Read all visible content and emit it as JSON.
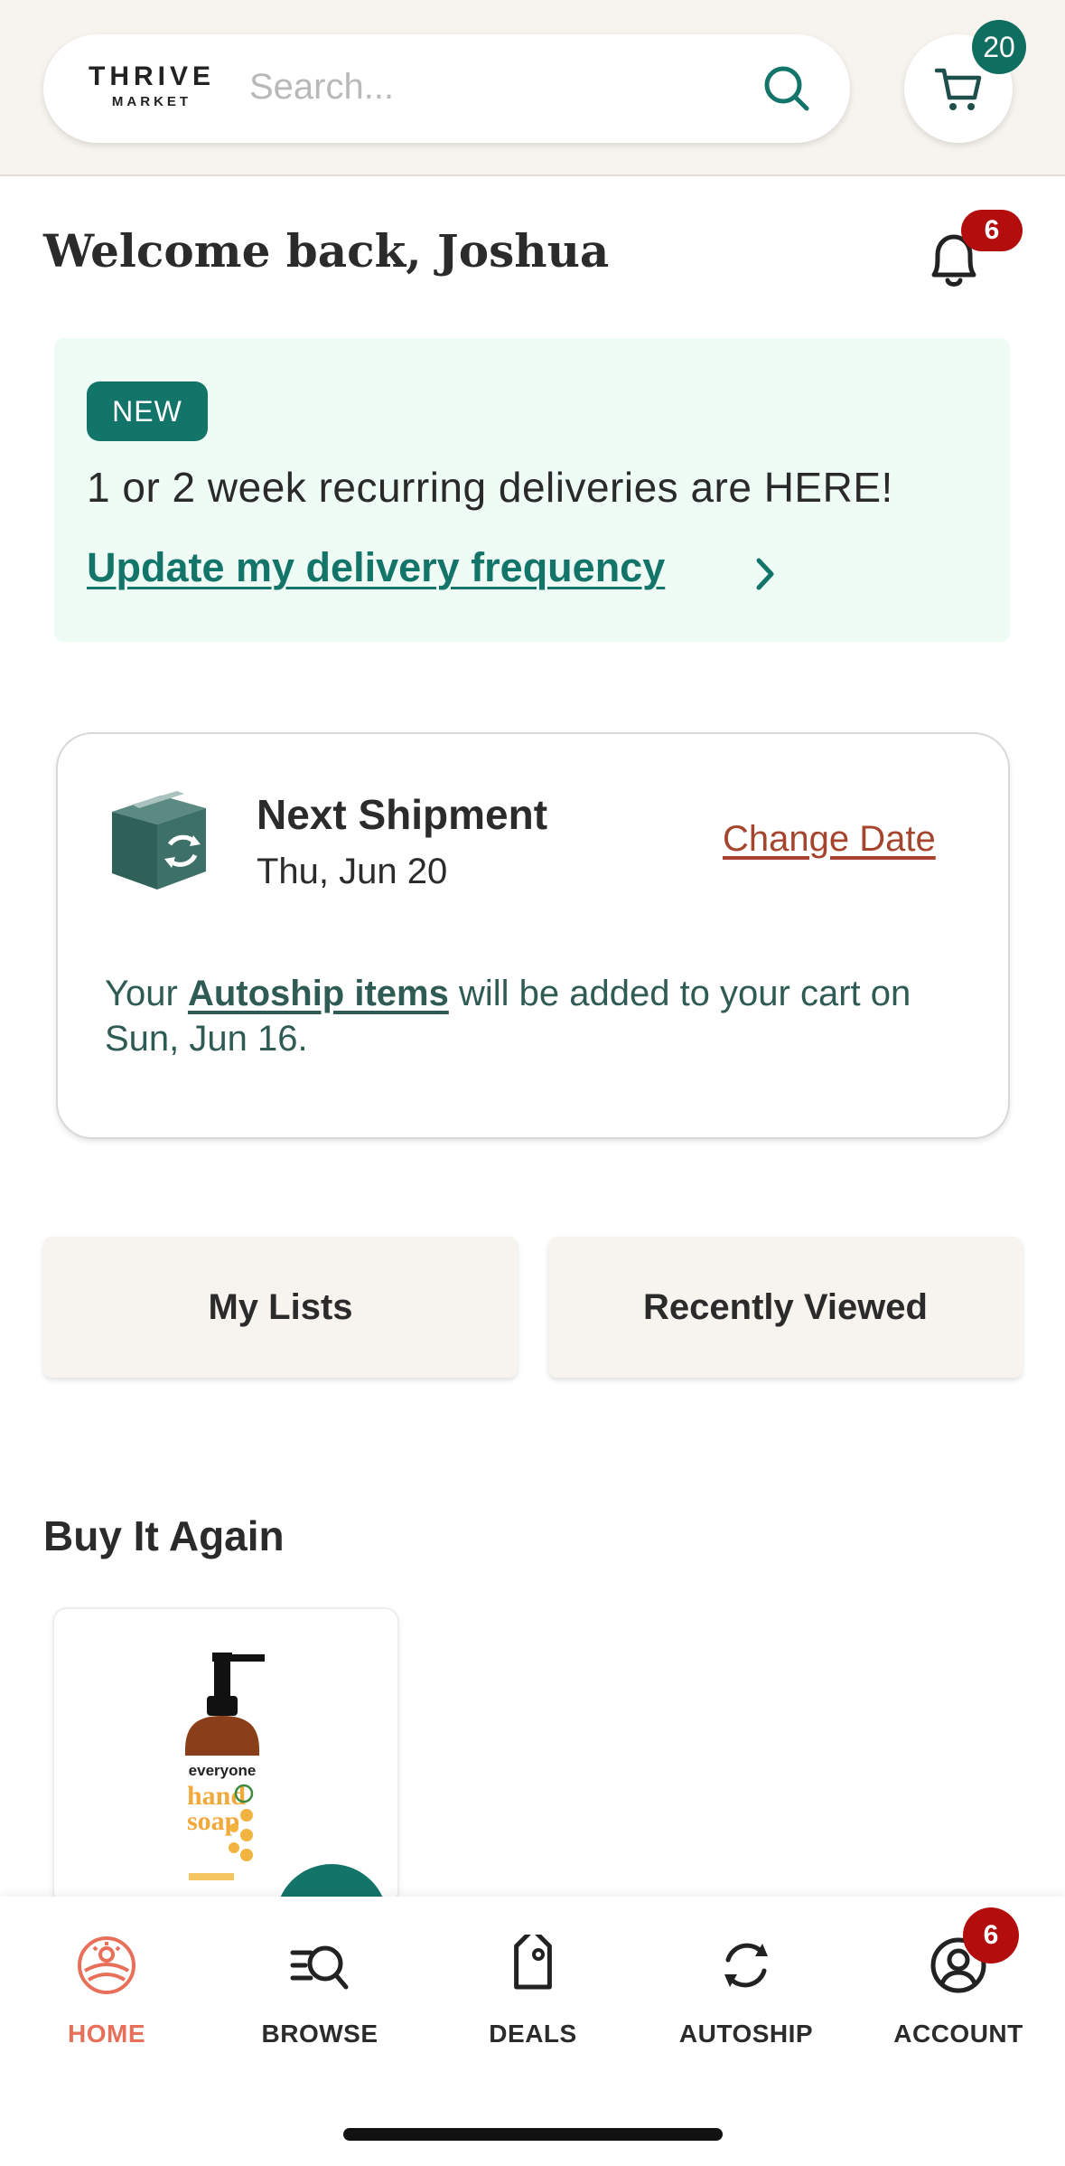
{
  "header": {
    "logo_line1": "THRIVE",
    "logo_line2": "MARKET",
    "search_placeholder": "Search...",
    "cart_count": "20"
  },
  "welcome": {
    "text": "Welcome back, Joshua",
    "notification_count": "6"
  },
  "promo": {
    "badge": "NEW",
    "message": "1 or 2 week recurring deliveries are HERE!",
    "link": "Update my delivery frequency"
  },
  "shipment": {
    "title": "Next Shipment",
    "date": "Thu, Jun 20",
    "change_date": "Change Date",
    "note_prefix": "Your ",
    "note_link": "Autoship items",
    "note_suffix": " will be added to your cart on Sun, Jun 16."
  },
  "quick_buttons": {
    "my_lists": "My Lists",
    "recently_viewed": "Recently Viewed"
  },
  "buy_again": {
    "title": "Buy It Again",
    "product_brand": "everyone",
    "product_name_line1": "hand",
    "product_name_line2": "soap"
  },
  "bottom_nav": {
    "home": "HOME",
    "browse": "BROWSE",
    "deals": "DEALS",
    "autoship": "AUTOSHIP",
    "account": "ACCOUNT",
    "account_badge": "6"
  },
  "colors": {
    "accent_green": "#13746a",
    "alert_red": "#b30d0d",
    "link_rust": "#a5452d",
    "home_active": "#e8705a",
    "header_bg": "#f7f3ee",
    "promo_bg": "#effbf5"
  }
}
